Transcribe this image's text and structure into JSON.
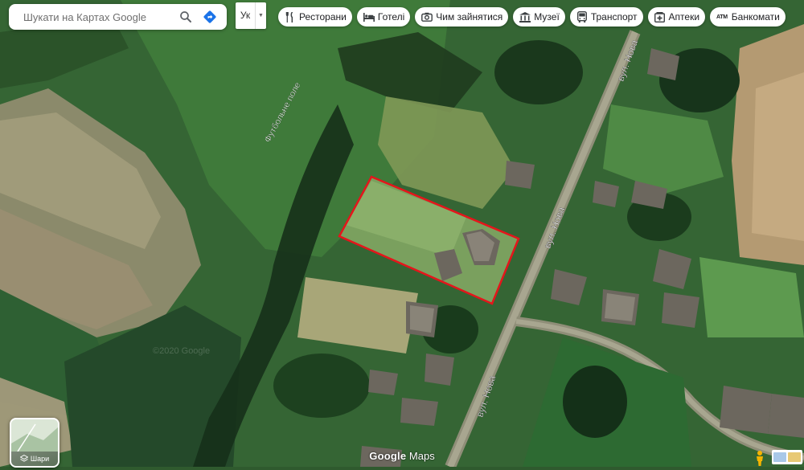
{
  "search": {
    "placeholder": "Шукати на Картах Google"
  },
  "language": {
    "label": "Ук"
  },
  "chips": [
    {
      "label": "Ресторани",
      "icon": "fork-knife-icon"
    },
    {
      "label": "Готелі",
      "icon": "bed-icon"
    },
    {
      "label": "Чим зайнятися",
      "icon": "camera-icon"
    },
    {
      "label": "Музеї",
      "icon": "museum-icon"
    },
    {
      "label": "Транспорт",
      "icon": "bus-icon"
    },
    {
      "label": "Аптеки",
      "icon": "pharmacy-icon"
    },
    {
      "label": "Банкомати",
      "icon": "atm-icon",
      "icon_text": "ATM"
    }
  ],
  "map_labels": {
    "football_field": "Футбольне поле",
    "street_1": "вул. Нова",
    "street_2": "вул. Нова",
    "street_3": "вул. Нова",
    "copyright_faint": "©2020 Google"
  },
  "layers": {
    "label": "Шари"
  },
  "watermark": {
    "brand": "Google",
    "product": "Maps"
  },
  "colors": {
    "highlight": "#e5151b",
    "road": "#9c9b86",
    "grass": "#3f7a3a"
  }
}
